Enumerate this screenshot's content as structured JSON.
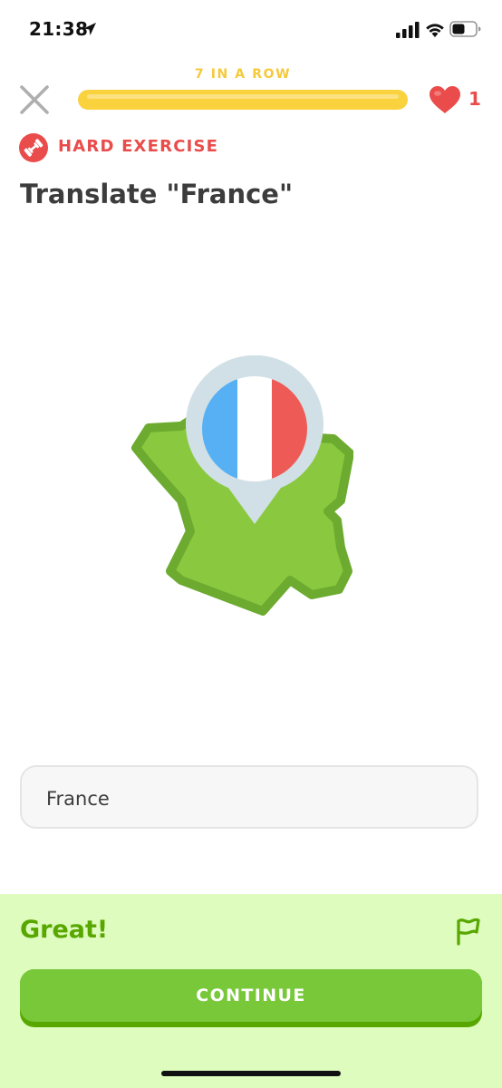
{
  "status_bar": {
    "time": "21:38"
  },
  "header": {
    "streak_label": "7 IN A ROW",
    "progress": 1.0,
    "hearts_count": "1"
  },
  "exercise": {
    "difficulty_label": "HARD EXERCISE",
    "prompt": "Translate \"France\""
  },
  "answer": {
    "value": "France"
  },
  "feedback": {
    "title": "Great!",
    "continue_label": "CONTINUE"
  },
  "colors": {
    "accent_green": "#78c83a",
    "feedback_bg": "#ddfcbd",
    "streak_yellow": "#fad23e",
    "heart_red": "#ea4b4b"
  },
  "icons": {
    "close": "close-icon",
    "heart": "heart-icon",
    "badge": "dumbbell-icon",
    "flag": "flag-icon"
  }
}
